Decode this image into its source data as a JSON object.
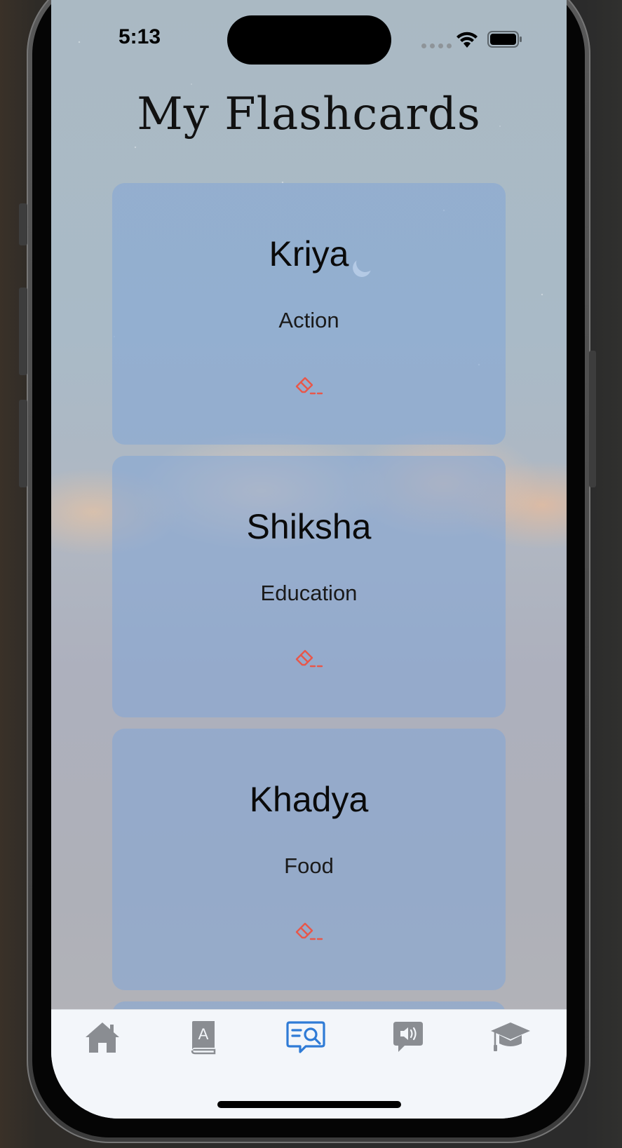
{
  "status_bar": {
    "time": "5:13"
  },
  "page": {
    "title": "My Flashcards"
  },
  "flashcards": [
    {
      "word": "Kriya",
      "meaning": "Action",
      "erase_icon": "eraser-icon"
    },
    {
      "word": "Shiksha",
      "meaning": "Education",
      "erase_icon": "eraser-icon"
    },
    {
      "word": "Khadya",
      "meaning": "Food",
      "erase_icon": "eraser-icon"
    }
  ],
  "tab_bar": {
    "tabs": [
      {
        "icon": "house-icon",
        "active": false
      },
      {
        "icon": "dictionary-book-icon",
        "active": false
      },
      {
        "icon": "flashcards-search-icon",
        "active": true
      },
      {
        "icon": "speech-bubble-speaker-icon",
        "active": false
      },
      {
        "icon": "graduation-cap-icon",
        "active": false
      }
    ]
  },
  "colors": {
    "accent_active_tab": "#2f7bd6",
    "inactive_tab": "#8a8d92",
    "erase_icon": "#e8574a",
    "card_background": "#82a5d7"
  }
}
